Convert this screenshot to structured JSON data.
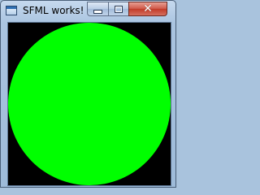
{
  "window": {
    "title": "SFML works!",
    "controls": {
      "minimize_icon": "minimize-icon",
      "maximize_icon": "maximize-icon",
      "close_icon": "close-icon",
      "close_glyph": "✕"
    }
  },
  "canvas": {
    "background_color": "#000000",
    "shape": "circle",
    "shape_color": "#00ff00"
  }
}
